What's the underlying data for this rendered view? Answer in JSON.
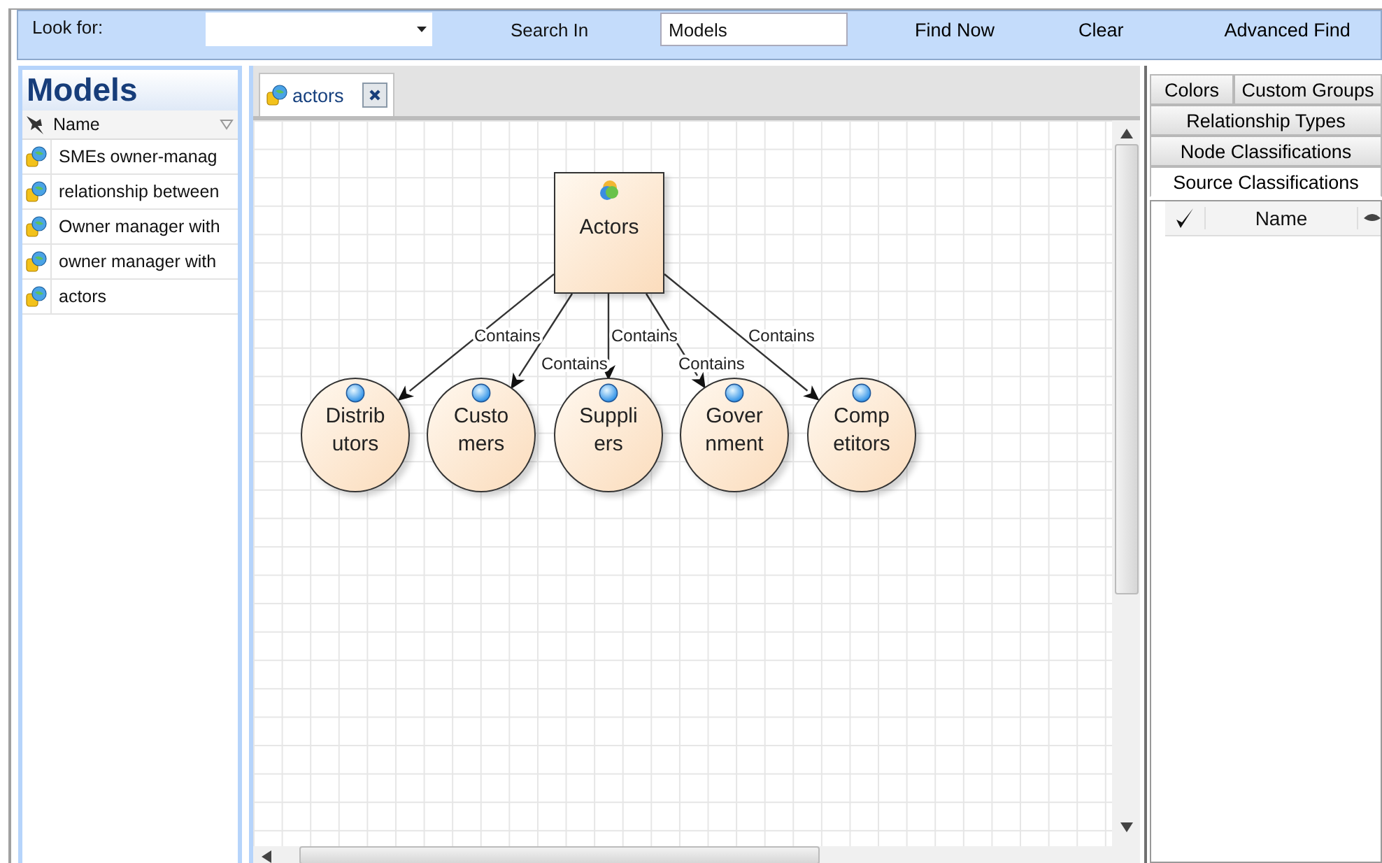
{
  "search_bar": {
    "look_for_label": "Look for:",
    "search_in_label": "Search In",
    "scope_value": "Models",
    "buttons": [
      "Find Now",
      "Clear",
      "Advanced Find"
    ]
  },
  "models_panel": {
    "title": "Models",
    "column": "Name",
    "items": [
      {
        "label": "SMEs  owner-manag"
      },
      {
        "label": "relationship between"
      },
      {
        "label": "Owner manager with"
      },
      {
        "label": "owner manager with"
      },
      {
        "label": "actors"
      }
    ]
  },
  "document_tabs": [
    {
      "label": "actors",
      "selected": true
    }
  ],
  "diagram": {
    "nodes": [
      {
        "kind": "box",
        "label_lines": [
          "Actors"
        ]
      },
      {
        "kind": "circle",
        "label_lines": [
          "Distrib",
          "utors"
        ]
      },
      {
        "kind": "circle",
        "label_lines": [
          "Custo",
          "mers"
        ]
      },
      {
        "kind": "circle",
        "label_lines": [
          "Suppli",
          "ers"
        ]
      },
      {
        "kind": "circle",
        "label_lines": [
          "Gover",
          "nment"
        ]
      },
      {
        "kind": "circle",
        "label_lines": [
          "Comp",
          "etitors"
        ]
      }
    ],
    "edges": [
      {
        "label": "Contains"
      },
      {
        "label": "Contains"
      },
      {
        "label": "Contains"
      },
      {
        "label": "Contains"
      },
      {
        "label": "Contains"
      }
    ]
  },
  "side_tabs": [
    [
      {
        "label": "Colors",
        "selected": false
      },
      {
        "label": "Custom Groups",
        "selected": false
      }
    ],
    [
      {
        "label": "Relationship Types",
        "selected": false
      }
    ],
    [
      {
        "label": "Node Classifications",
        "selected": false
      }
    ],
    [
      {
        "label": "Source Classifications",
        "selected": true
      }
    ]
  ],
  "side_grid": {
    "column": "Name"
  }
}
